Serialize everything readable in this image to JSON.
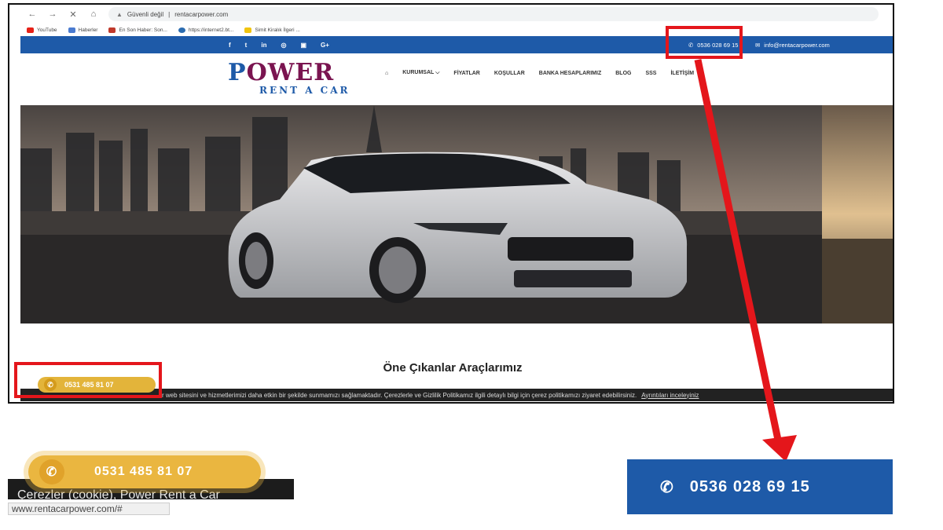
{
  "browser": {
    "security_label": "Güvenli değil",
    "url": "rentacarpower.com",
    "bookmarks": [
      {
        "label": "YouTube",
        "color": "#e62117"
      },
      {
        "label": "Haberler",
        "color": "#4a7bd0"
      },
      {
        "label": "En Son Haber: Son...",
        "color": "#c0392b"
      },
      {
        "label": "https://internet2.bt...",
        "color": "#2b6cb0"
      },
      {
        "label": "Simit Kiralık İlgeri ...",
        "color": "#f1c40f"
      }
    ]
  },
  "site": {
    "colors": {
      "brand_blue": "#1e5aa8",
      "brand_magenta": "#7a1450",
      "call_yellow": "#eab640",
      "highlight_red": "#e4161b"
    },
    "topbar": {
      "social_icons": [
        "f",
        "t",
        "in",
        "◎",
        "▣",
        "G+"
      ],
      "phone": "0536 028 69 15",
      "email": "info@rentacarpower.com"
    },
    "logo": {
      "power_first": "P",
      "power_rest": "OWER",
      "sub": "RENT A CAR"
    },
    "nav": {
      "home_icon": "⌂",
      "items": [
        "KURUMSAL ⌵",
        "FİYATLAR",
        "KOŞULLAR",
        "BANKA HESAPLARIMIZ",
        "BLOG",
        "SSS",
        "İLETİŞİM"
      ]
    },
    "section_title": "Öne Çıkanlar Araçlarımız",
    "cookie_text": "r web sitesini ve hizmetlerimizi daha etkin bir şekilde sunmamızı sağlamaktadır. Çerezlerle ve Gizlilik Politikamız ilgili detaylı bilgi için çerez politikamızı ziyaret edebilirsiniz.",
    "cookie_link": "Ayrıntıları inceleyiniz",
    "float_call": "0531 485 81 07"
  },
  "zoom": {
    "call_number": "0531 485 81 07",
    "cookie_text": "Çerezler (cookie), Power Rent a Car",
    "status_url": "www.rentacarpower.com/#",
    "phone_banner": "0536 028 69 15",
    "phone_icon": "✆"
  }
}
